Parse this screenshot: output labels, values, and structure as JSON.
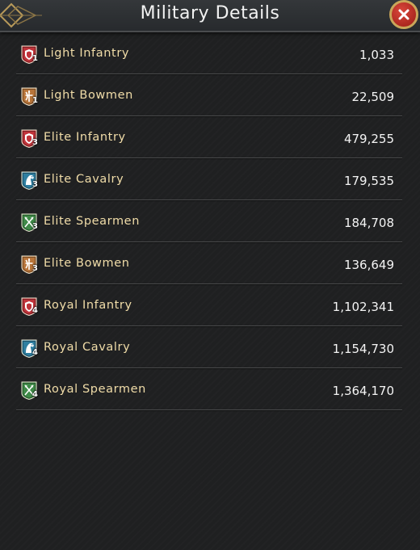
{
  "header": {
    "title": "Military Details"
  },
  "units": [
    {
      "name": "Light Infantry",
      "count": "1,033",
      "tier": "1",
      "icon": "shield-icon",
      "color": "#c0333a"
    },
    {
      "name": "Light Bowmen",
      "count": "22,509",
      "tier": "1",
      "icon": "bow-icon",
      "color": "#b8753a"
    },
    {
      "name": "Elite Infantry",
      "count": "479,255",
      "tier": "3",
      "icon": "shield-icon",
      "color": "#c0333a"
    },
    {
      "name": "Elite Cavalry",
      "count": "179,535",
      "tier": "3",
      "icon": "horse-icon",
      "color": "#2f7fa1"
    },
    {
      "name": "Elite Spearmen",
      "count": "184,708",
      "tier": "3",
      "icon": "spear-icon",
      "color": "#3f8a48"
    },
    {
      "name": "Elite Bowmen",
      "count": "136,649",
      "tier": "3",
      "icon": "bow-icon",
      "color": "#b8753a"
    },
    {
      "name": "Royal Infantry",
      "count": "1,102,341",
      "tier": "4",
      "icon": "shield-icon",
      "color": "#c0333a"
    },
    {
      "name": "Royal Cavalry",
      "count": "1,154,730",
      "tier": "4",
      "icon": "horse-icon",
      "color": "#2f7fa1"
    },
    {
      "name": "Royal Spearmen",
      "count": "1,364,170",
      "tier": "4",
      "icon": "spear-icon",
      "color": "#3f8a48"
    }
  ],
  "colors": {
    "name_text": "#f0dca8",
    "count_text": "#f4f4f4",
    "accent_gold": "#c9a65a"
  }
}
